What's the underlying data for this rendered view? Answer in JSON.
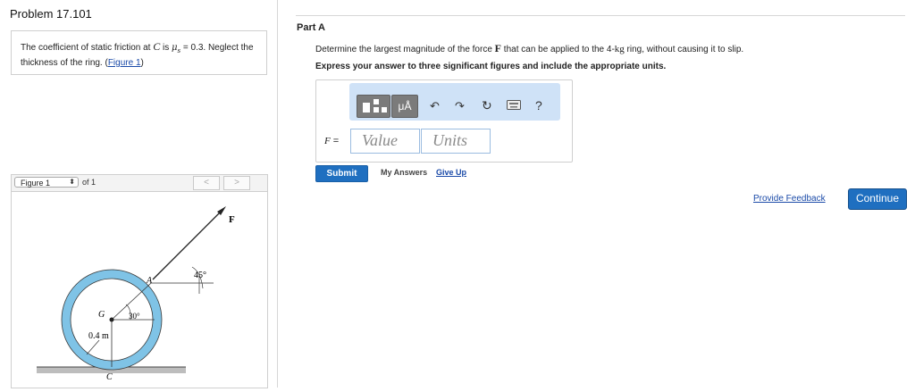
{
  "problem": {
    "title": "Problem 17.101",
    "text_prefix": "The coefficient of static friction at ",
    "point": "C",
    "text_is": " is ",
    "mu_symbol": "μ",
    "mu_sub": "s",
    "mu_value": " = 0.3. Neglect the thickness of the ring. (",
    "figure_link": "Figure 1",
    "text_suffix": ")"
  },
  "figure_nav": {
    "selected": "Figure 1",
    "of_text": "of 1",
    "prev": "<",
    "next": ">"
  },
  "figure": {
    "labels": {
      "force": "F",
      "angle_force": "45°",
      "point_a": "A",
      "center": "G",
      "angle_center": "30°",
      "radius": "0.4 m",
      "point_c": "C"
    }
  },
  "part": {
    "label": "Part A",
    "question_pre": "Determine the largest magnitude of the force ",
    "force_symbol": "F",
    "question_mid": " that can be applied to the 4-",
    "unit": "kg",
    "question_post": " ring, without causing it to slip.",
    "instruction": "Express your answer to three significant figures and include the appropriate units."
  },
  "answer": {
    "toolbar_mu": "μÅ",
    "toolbar_help": "?",
    "var_label": "F",
    "equals": "=",
    "value_placeholder": "Value",
    "units_placeholder": "Units"
  },
  "actions": {
    "submit": "Submit",
    "my_answers": "My Answers",
    "give_up": "Give Up",
    "feedback": "Provide Feedback",
    "continue": "Continue"
  },
  "colors": {
    "accent": "#1f6fc0",
    "toolbar_bg": "#cfe2f7",
    "ring_blue": "#7fc3e6",
    "link": "#1a4aa8"
  }
}
